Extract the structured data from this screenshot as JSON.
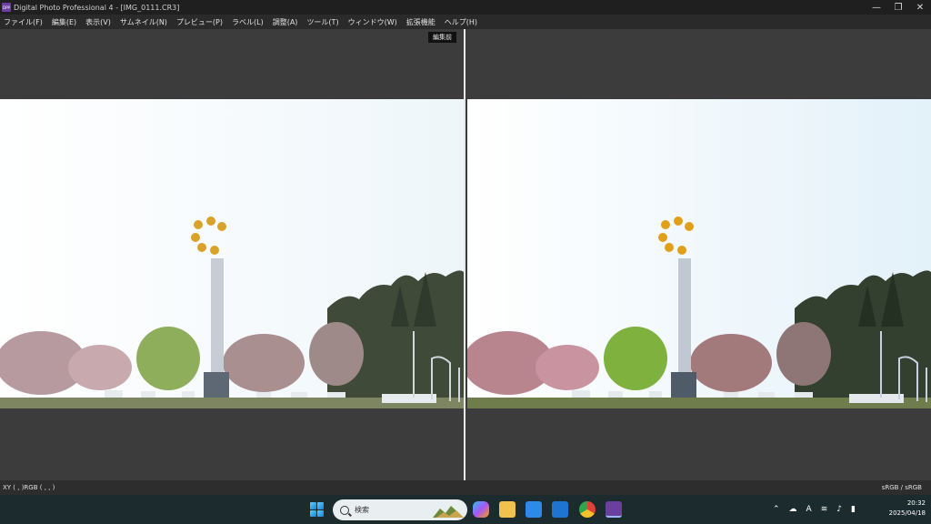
{
  "window": {
    "title": "Digital Photo Professional 4 - [IMG_0111.CR3]",
    "app_icon_text": "DPP",
    "minimize_glyph": "—",
    "maximize_glyph": "❐",
    "close_glyph": "✕"
  },
  "menu": {
    "items": [
      "ファイル(F)",
      "編集(E)",
      "表示(V)",
      "サムネイル(N)",
      "プレビュー(P)",
      "ラベル(L)",
      "調整(A)",
      "ツール(T)",
      "ウィンドウ(W)",
      "拡張機能",
      "ヘルプ(H)"
    ]
  },
  "viewer": {
    "before_label": "編集前"
  },
  "status": {
    "coords": "XY (    ,    )RGB (    ,    ,    )",
    "color_space": "sRGB / sRGB"
  },
  "taskbar": {
    "search_placeholder": "検索",
    "ime_indicator": "A",
    "time": "20:32",
    "date": "2025/04/18",
    "icons": [
      "windows-start-icon",
      "search-icon",
      "copilot-icon",
      "file-explorer-icon",
      "microsoft-store-icon",
      "mail-icon",
      "chrome-icon",
      "dpp-icon"
    ]
  },
  "colors": {
    "titlebar": "#1f1f1f",
    "menubar": "#2a2a2a",
    "workspace": "#3c3c3c",
    "taskbar": "#1c2b2e",
    "dpp_accent": "#6b3fa0"
  }
}
